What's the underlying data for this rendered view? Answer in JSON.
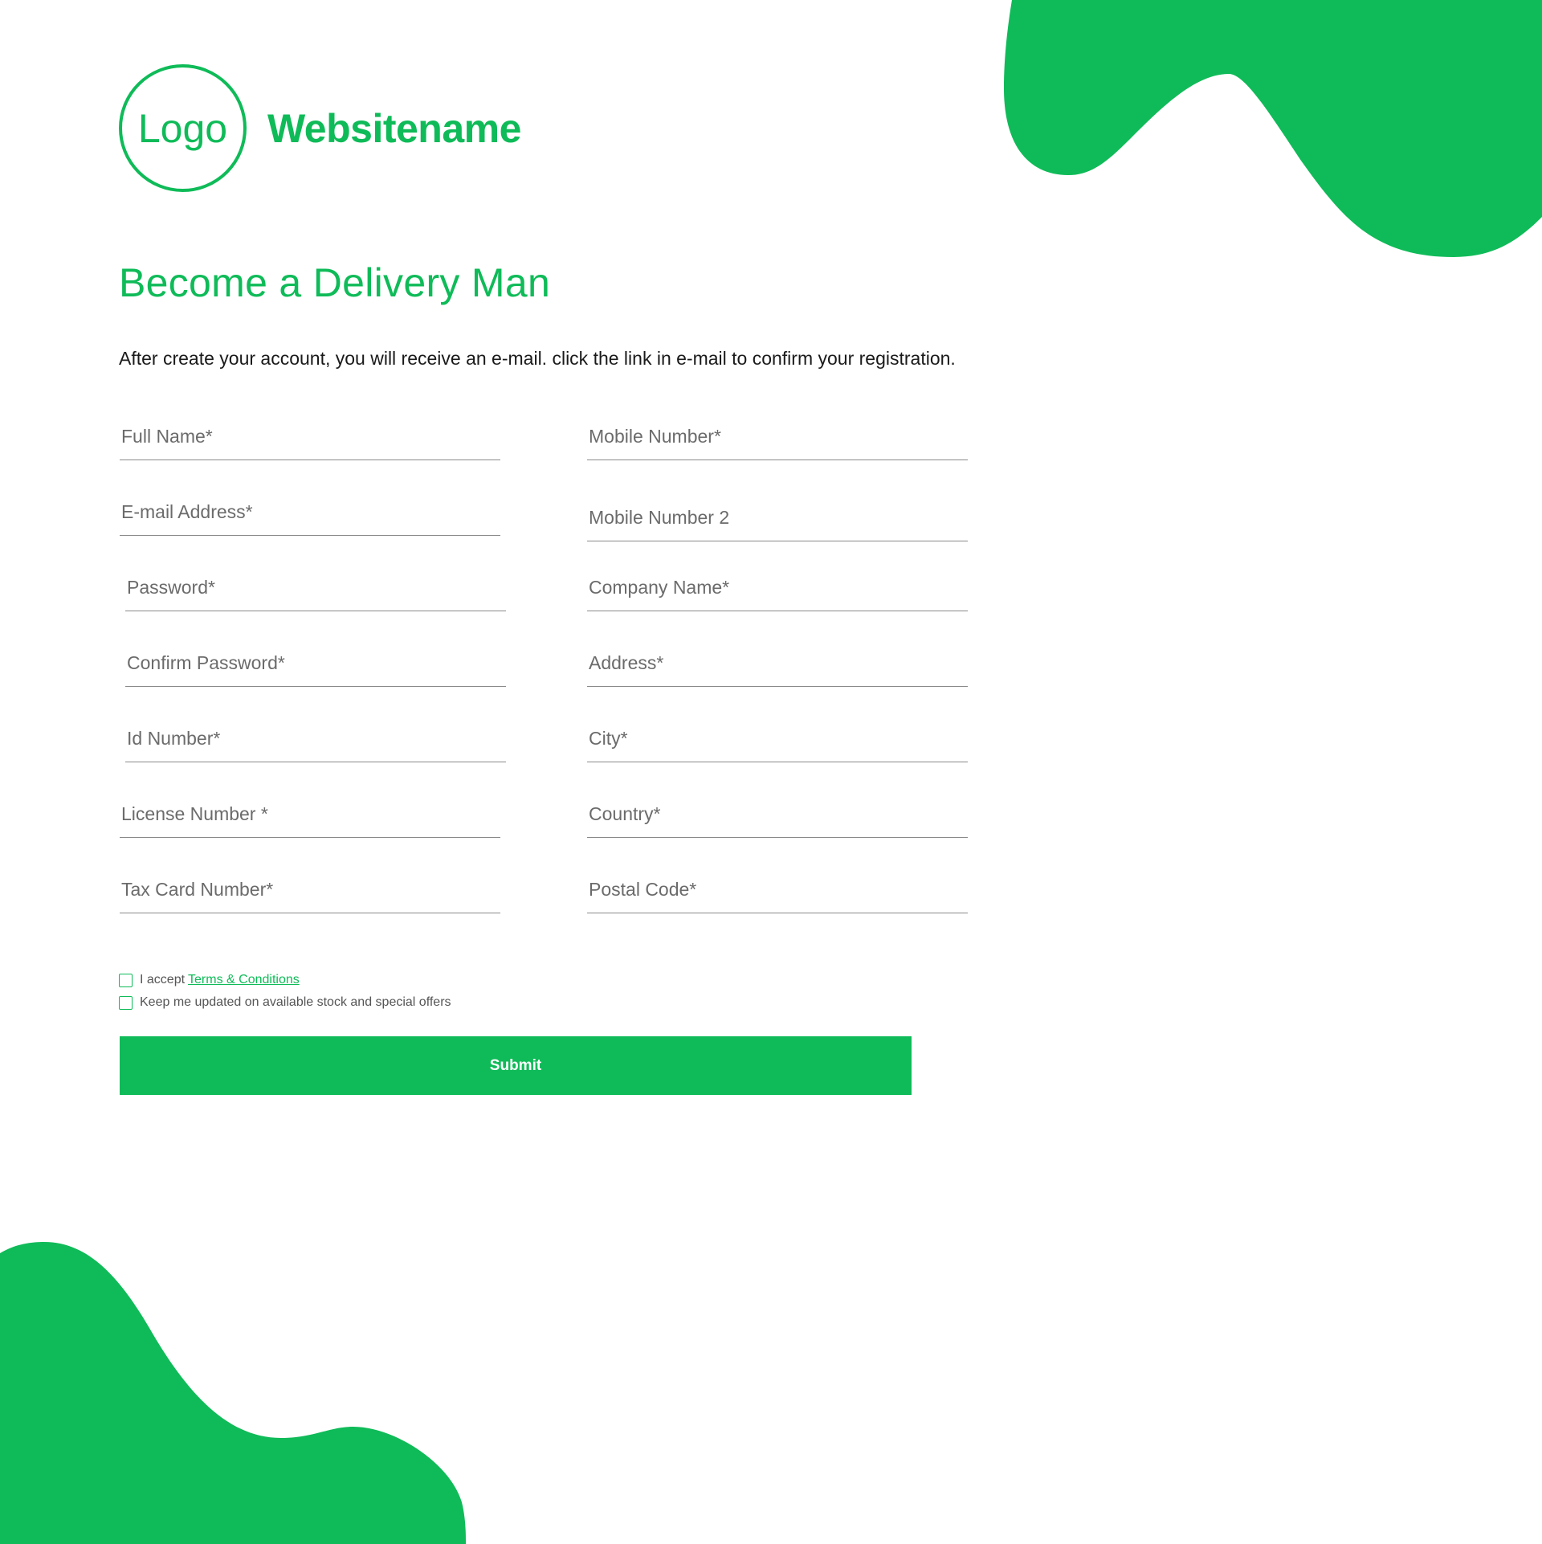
{
  "brand": {
    "logo_text": "Logo",
    "site_name": "Websitename",
    "color": "#0fbb58"
  },
  "page": {
    "title": "Become a Delivery Man",
    "subtitle": "After create your account, you will receive an e-mail. click the link in e-mail to confirm your registration."
  },
  "form": {
    "left_fields": [
      {
        "label": "Full Name*"
      },
      {
        "label": "E-mail Address*"
      },
      {
        "label": "Password*"
      },
      {
        "label": "Confirm Password*"
      },
      {
        "label": "Id Number*"
      },
      {
        "label": "License Number *"
      },
      {
        "label": "Tax Card Number*"
      }
    ],
    "right_fields": [
      {
        "label": "Mobile Number*"
      },
      {
        "label": "Mobile Number 2"
      },
      {
        "label": "Company Name*"
      },
      {
        "label": "Address*"
      },
      {
        "label": "City*"
      },
      {
        "label": "Country*"
      },
      {
        "label": "Postal Code*"
      }
    ],
    "terms": {
      "prefix": "I accept",
      "link_label": "Terms & Conditions"
    },
    "updates_label": "Keep me updated on available stock and special offers",
    "submit_label": "Submit"
  }
}
